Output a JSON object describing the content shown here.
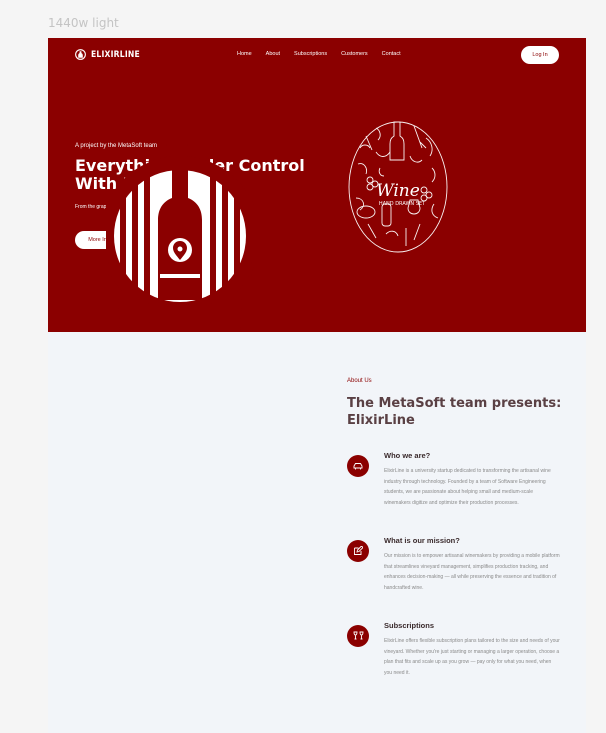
{
  "frame_label": "1440w light",
  "nav": {
    "brand": "ELIXIRLINE",
    "links": [
      "Home",
      "About",
      "Subscriptions",
      "Customers",
      "Contact"
    ],
    "login": "Log In"
  },
  "hero": {
    "kicker": "A project by the MetaSoft team",
    "headline": "Everything Under Control With ELIXIRLINE",
    "tagline": "From the grape to the bottle...",
    "cta": "More Information",
    "art_title": "Wine",
    "art_subtitle": "HAND DRAWN SET"
  },
  "about": {
    "kicker": "About Us",
    "title": "The MetaSoft team presents: ElixirLine",
    "features": [
      {
        "title": "Who we are?",
        "icon": "car-icon",
        "text": "ElixirLine is a university startup dedicated to transforming the artisanal wine industry through technology. Founded by a team of Software Engineering students, we are passionate about helping small and medium-scale winemakers digitize and optimize their production processes."
      },
      {
        "title": "What is our mission?",
        "icon": "edit-icon",
        "text": "Our mission is to empower artisanal winemakers by providing a mobile platform that streamlines vineyard management, simplifies production tracking, and enhances decision-making — all while preserving the essence and tradition of handcrafted wine."
      },
      {
        "title": "Subscriptions",
        "icon": "wine-glasses-icon",
        "text": "ElixirLine offers flexible subscription plans tailored to the size and needs of your vineyard. Whether you're just starting or managing a larger operation, choose a plan that fits and scale up as you grow — pay only for what you need, when you need it."
      }
    ]
  },
  "colors": {
    "primary": "#8b0000",
    "background": "#f2f5f9"
  }
}
